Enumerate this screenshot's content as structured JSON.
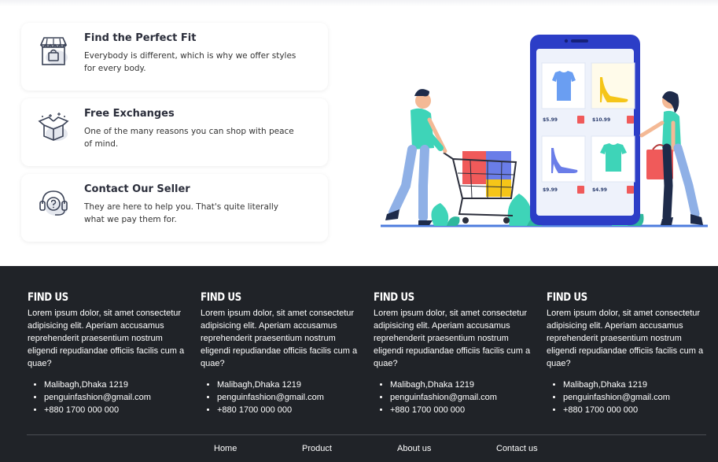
{
  "features": [
    {
      "title": "Find the Perfect Fit",
      "desc": "Everybody is different, which is why we offer styles for every body.",
      "icon": "store-icon"
    },
    {
      "title": "Free Exchanges",
      "desc": "One of the many reasons you can shop with peace of mind.",
      "icon": "open-box-icon"
    },
    {
      "title": "Contact Our Seller",
      "desc": "They are here to help you. That's quite literally what we pay them for.",
      "icon": "headset-support-icon"
    }
  ],
  "illustration": {
    "prices": [
      "$5.99",
      "$10.99",
      "$9.99",
      "$4.99"
    ],
    "colors": {
      "phone": "#2c3ec7",
      "screen": "#eef2fb",
      "teal": "#3ed4b8",
      "shelf": "#4d7cde"
    }
  },
  "footer": {
    "columns": [
      {
        "heading": "FIND US",
        "text": "Lorem ipsum dolor, sit amet consectetur adipisicing elit. Aperiam accusamus reprehenderit praesentium nostrum eligendi repudiandae officiis facilis cum a quae?",
        "items": [
          "Malibagh,Dhaka 1219",
          "penguinfashion@gmail.com",
          "+880 1700 000 000"
        ]
      },
      {
        "heading": "FIND US",
        "text": "Lorem ipsum dolor, sit amet consectetur adipisicing elit. Aperiam accusamus reprehenderit praesentium nostrum eligendi repudiandae officiis facilis cum a quae?",
        "items": [
          "Malibagh,Dhaka 1219",
          "penguinfashion@gmail.com",
          "+880 1700 000 000"
        ]
      },
      {
        "heading": "FIND US",
        "text": "Lorem ipsum dolor, sit amet consectetur adipisicing elit. Aperiam accusamus reprehenderit praesentium nostrum eligendi repudiandae officiis facilis cum a quae?",
        "items": [
          "Malibagh,Dhaka 1219",
          "penguinfashion@gmail.com",
          "+880 1700 000 000"
        ]
      },
      {
        "heading": "FIND US",
        "text": "Lorem ipsum dolor, sit amet consectetur adipisicing elit. Aperiam accusamus reprehenderit praesentium nostrum eligendi repudiandae officiis facilis cum a quae?",
        "items": [
          "Malibagh,Dhaka 1219",
          "penguinfashion@gmail.com",
          "+880 1700 000 000"
        ]
      }
    ],
    "nav": [
      "Home",
      "Product",
      "About us",
      "Contact us"
    ],
    "colors": {
      "background": "#202328",
      "divider": "#4a4d53"
    }
  }
}
